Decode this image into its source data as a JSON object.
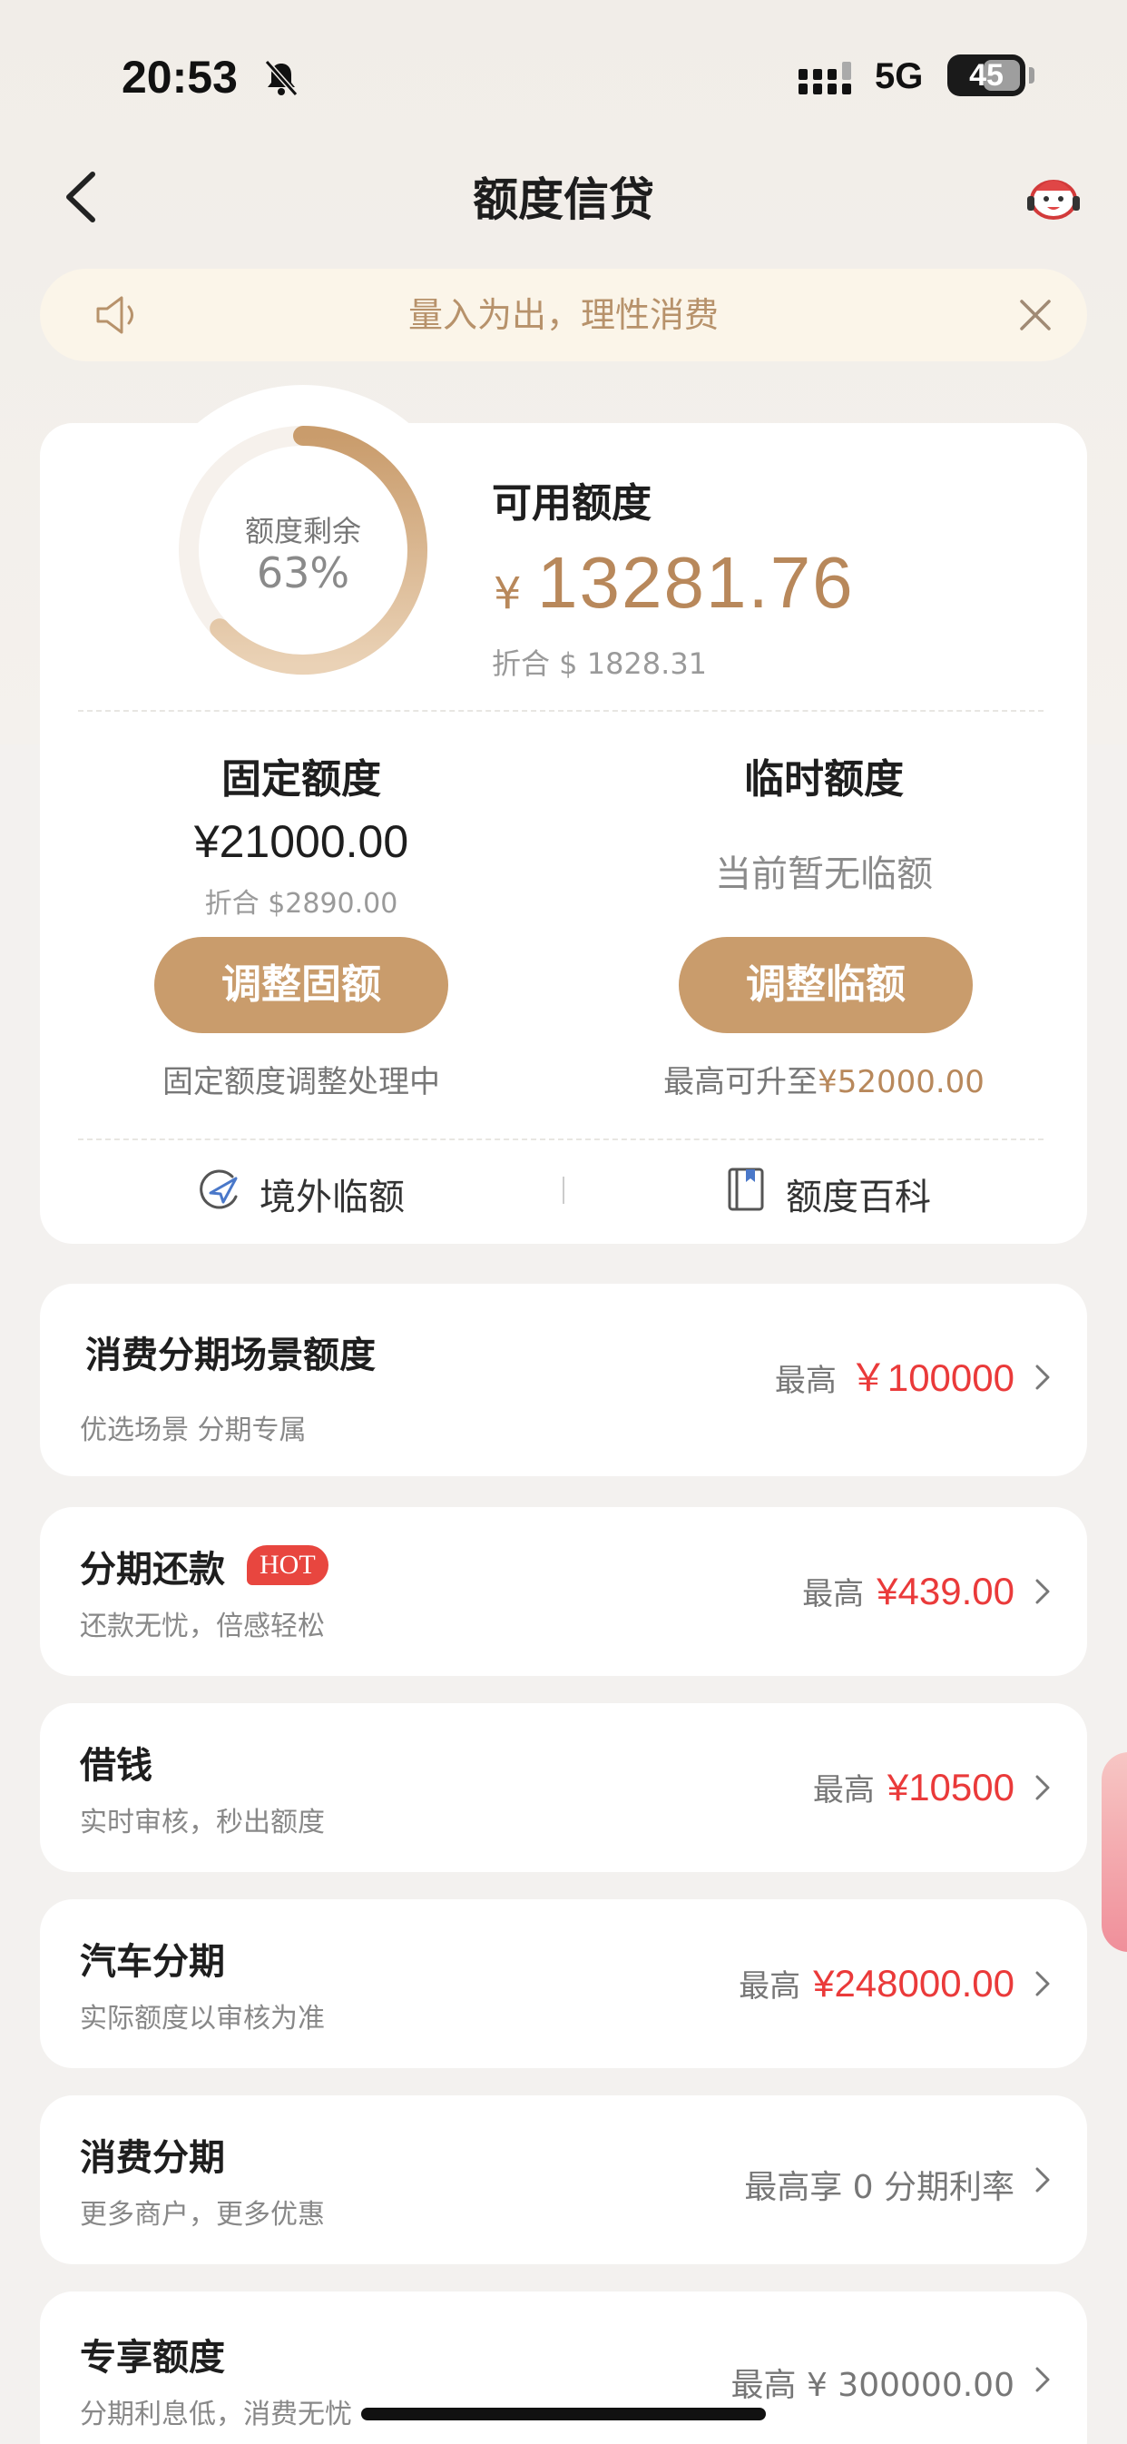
{
  "status_bar": {
    "time": "20:53",
    "network": "5G",
    "battery": "45"
  },
  "nav": {
    "title": "额度信贷"
  },
  "notice": {
    "text": "量入为出，理性消费"
  },
  "summary": {
    "ring_label": "额度剩余",
    "ring_percent": "63%",
    "ring_fraction": 0.63,
    "available_label": "可用额度",
    "currency_symbol": "¥",
    "available_amount": "13281.76",
    "available_usd": "折合 $ 1828.31",
    "fixed": {
      "title": "固定额度",
      "amount": "¥21000.00",
      "usd": "折合 $2890.00",
      "button": "调整固额",
      "note": "固定额度调整处理中"
    },
    "temporary": {
      "title": "临时额度",
      "status": "当前暂无临额",
      "button": "调整临额",
      "note_prefix": "最高可升至",
      "note_amount": "¥52000.00"
    },
    "links": [
      {
        "label": "境外临额",
        "icon": "overseas-plane-icon"
      },
      {
        "label": "额度百科",
        "icon": "book-icon"
      }
    ]
  },
  "list": [
    {
      "title": "消费分期场景额度",
      "subtitle": "优选场景 分期专属",
      "prefix": "最高",
      "amount": "￥100000"
    },
    {
      "title": "分期还款",
      "badge": "HOT",
      "subtitle": "还款无忧，倍感轻松",
      "prefix": "最高",
      "amount": "¥439.00"
    },
    {
      "title": "借钱",
      "subtitle": "实时审核，秒出额度",
      "prefix": "最高",
      "amount": "¥10500"
    },
    {
      "title": "汽车分期",
      "subtitle": "实际额度以审核为准",
      "prefix": "最高",
      "amount": "¥248000.00"
    },
    {
      "title": "消费分期",
      "subtitle": "更多商户，更多优惠",
      "text": "最高享 0 分期利率"
    },
    {
      "title": "专享额度",
      "subtitle": "分期利息低，消费无忧",
      "text": "最高 ¥ 300000.00"
    }
  ],
  "colors": {
    "accent": "#c99c6c",
    "gold_text": "#b8885b",
    "price_red": "#ea3a3a",
    "notice_bg": "#fbf5e9"
  }
}
